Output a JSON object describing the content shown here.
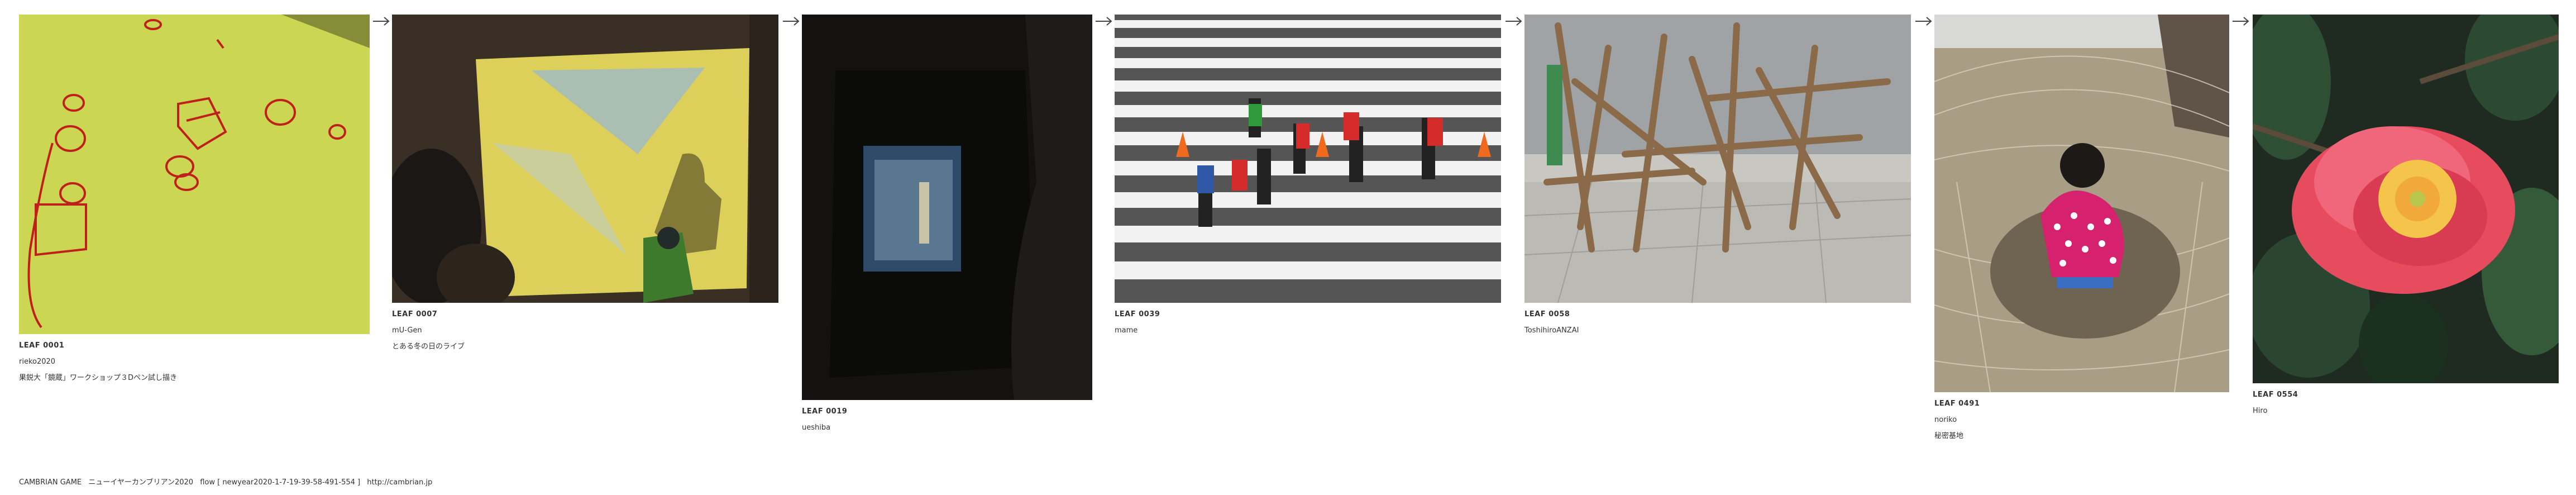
{
  "leaves": [
    {
      "id": "LEAF 0001",
      "author": "rieko2020",
      "title": "果鋭大「鏡蔵」ワークショップ３Dペン試し描き"
    },
    {
      "id": "LEAF 0007",
      "author": "mU-Gen",
      "title": "とある冬の日のライブ"
    },
    {
      "id": "LEAF 0019",
      "author": "ueshiba",
      "title": ""
    },
    {
      "id": "LEAF 0039",
      "author": "mame",
      "title": ""
    },
    {
      "id": "LEAF 0058",
      "author": "ToshihiroANZAI",
      "title": ""
    },
    {
      "id": "LEAF 0491",
      "author": "noriko",
      "title": "秘密基地"
    },
    {
      "id": "LEAF 0554",
      "author": "Hiro",
      "title": ""
    }
  ],
  "footer": {
    "brand": "CAMBRIAN GAME",
    "game_title": "ニューイヤーカンブリアン2020",
    "flow": "flow [ newyear2020-1-7-19-39-58-491-554 ]",
    "url": "http://cambrian.jp"
  },
  "icons": [
    "arrow-right-icon"
  ]
}
